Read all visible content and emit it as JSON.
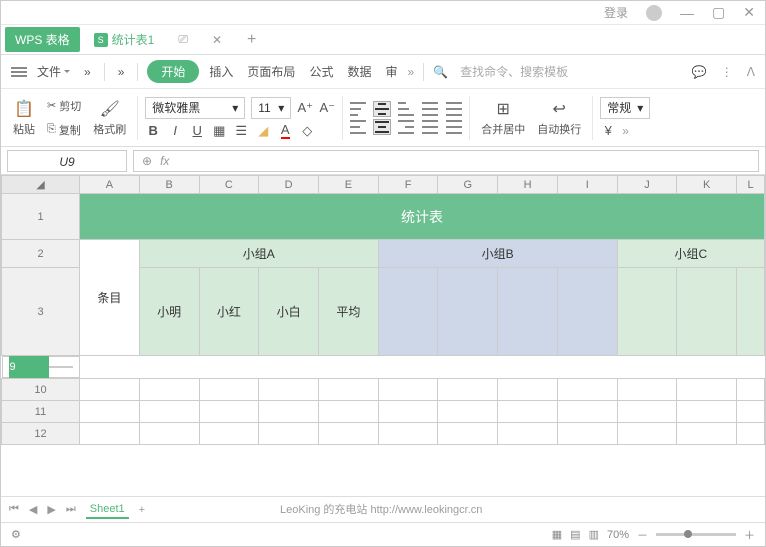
{
  "title": {
    "login": "登录",
    "app": "WPS 表格",
    "file": "统计表1"
  },
  "menu": {
    "file": "文件",
    "start": "开始",
    "insert": "插入",
    "layout": "页面布局",
    "formula": "公式",
    "data": "数据",
    "review": "审",
    "search": "查找命令、搜索模板"
  },
  "ribbon": {
    "paste": "粘贴",
    "cut": "剪切",
    "copy": "复制",
    "format_painter": "格式刷",
    "font": "微软雅黑",
    "size": "11",
    "merge": "合并居中",
    "wrap": "自动换行",
    "numfmt": "常规"
  },
  "cellref": "U9",
  "cols": [
    "A",
    "B",
    "C",
    "D",
    "E",
    "F",
    "G",
    "H",
    "I",
    "J",
    "K",
    "L"
  ],
  "rows_left": [
    "1",
    "2",
    "3",
    "9",
    "10",
    "11",
    "12"
  ],
  "cells": {
    "title": "统计表",
    "item": "条目",
    "gA": "小组A",
    "gB": "小组B",
    "gC": "小组C",
    "n1": "小明",
    "n2": "小红",
    "n3": "小白",
    "n4": "平均"
  },
  "sheet": {
    "name": "Sheet1"
  },
  "status": {
    "zoom": "70%"
  },
  "watermark": "LeoKing 的充电站  http://www.leokingcr.cn"
}
